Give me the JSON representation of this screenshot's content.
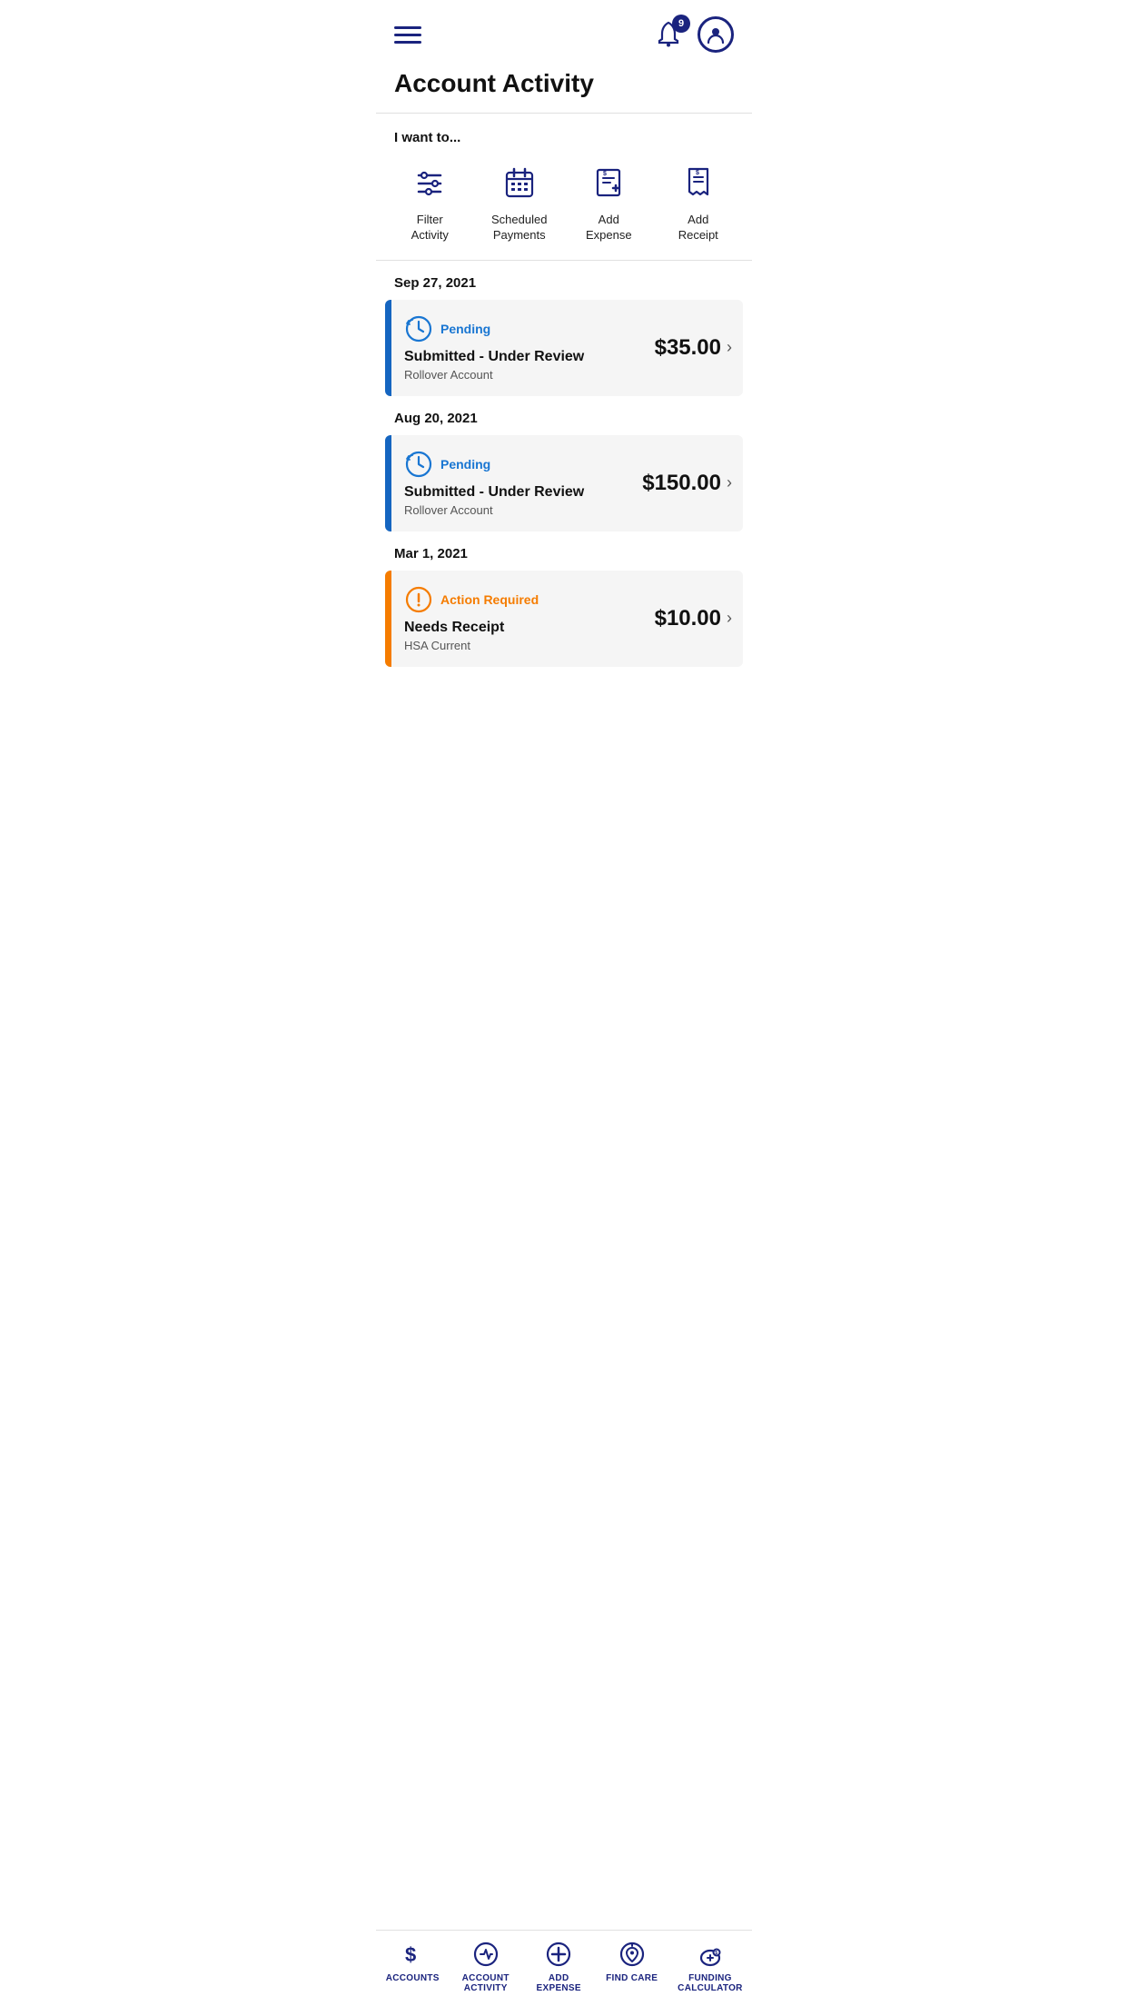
{
  "header": {
    "notification_count": "9",
    "page_title": "Account Activity"
  },
  "quick_actions": {
    "section_label": "I want to...",
    "items": [
      {
        "id": "filter-activity",
        "label": "Filter\nActivity"
      },
      {
        "id": "scheduled-payments",
        "label": "Scheduled\nPayments"
      },
      {
        "id": "add-expense",
        "label": "Add\nExpense"
      },
      {
        "id": "add-receipt",
        "label": "Add\nReceipt"
      }
    ]
  },
  "activity": {
    "groups": [
      {
        "date": "Sep 27, 2021",
        "entries": [
          {
            "status_type": "pending",
            "status_label": "Pending",
            "title": "Submitted - Under Review",
            "subtitle": "Rollover Account",
            "amount": "$35.00",
            "border_color": "blue"
          }
        ]
      },
      {
        "date": "Aug 20, 2021",
        "entries": [
          {
            "status_type": "pending",
            "status_label": "Pending",
            "title": "Submitted - Under Review",
            "subtitle": "Rollover Account",
            "amount": "$150.00",
            "border_color": "blue"
          }
        ]
      },
      {
        "date": "Mar 1, 2021",
        "entries": [
          {
            "status_type": "action",
            "status_label": "Action Required",
            "title": "Needs Receipt",
            "subtitle": "HSA Current",
            "amount": "$10.00",
            "border_color": "orange"
          }
        ]
      }
    ]
  },
  "bottom_nav": {
    "items": [
      {
        "id": "accounts",
        "label": "ACCOUNTS"
      },
      {
        "id": "account-activity",
        "label": "ACCOUNT\nACTIVITY"
      },
      {
        "id": "add-expense",
        "label": "ADD\nEXPENSE"
      },
      {
        "id": "find-care",
        "label": "FIND CARE"
      },
      {
        "id": "funding-calculator",
        "label": "FUNDING\nCALCULATOR"
      }
    ]
  }
}
